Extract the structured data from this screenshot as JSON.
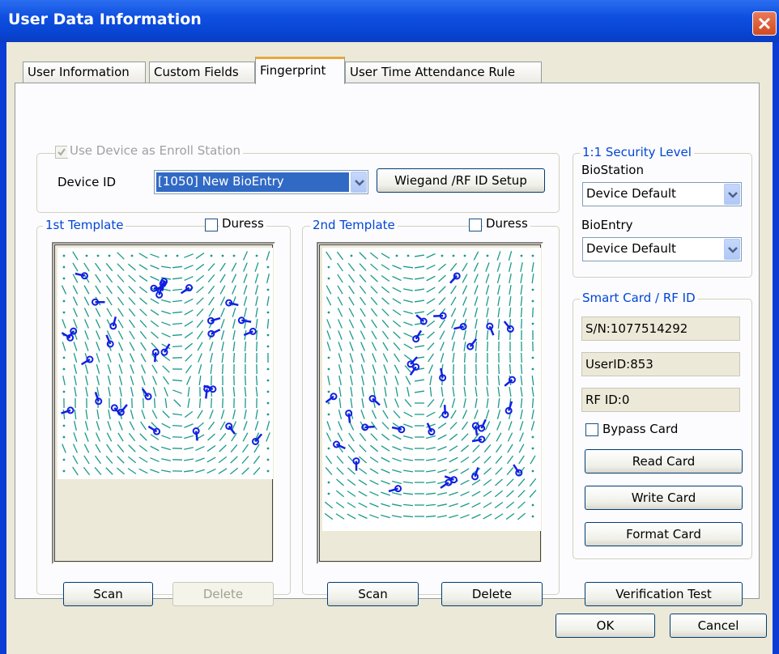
{
  "window": {
    "title": "User Data Information"
  },
  "tabs": [
    {
      "label": "User Information",
      "active": false
    },
    {
      "label": "Custom Fields",
      "active": false
    },
    {
      "label": "Fingerprint",
      "active": true
    },
    {
      "label": "User Time Attendance Rule",
      "active": false
    }
  ],
  "enroll": {
    "checkbox_label": "Use Device as Enroll Station",
    "checked": true,
    "enabled": false,
    "device_id_label": "Device ID",
    "device_id_value": "[1050] New BioEntry",
    "wiegand_button": "Wiegand /RF ID Setup"
  },
  "template1": {
    "title": "1st Template",
    "duress_label": "Duress",
    "duress_checked": false,
    "scan_label": "Scan",
    "delete_label": "Delete",
    "delete_enabled": false
  },
  "template2": {
    "title": "2nd Template",
    "duress_label": "Duress",
    "duress_checked": false,
    "scan_label": "Scan",
    "delete_label": "Delete",
    "delete_enabled": true
  },
  "security": {
    "title": "1:1 Security Level",
    "biostation_label": "BioStation",
    "biostation_value": "Device Default",
    "bioentry_label": "BioEntry",
    "bioentry_value": "Device Default"
  },
  "smartcard": {
    "title": "Smart Card / RF ID",
    "serial": "S/N:1077514292",
    "userid": "UserID:853",
    "rfid": "RF ID:0",
    "bypass_label": "Bypass Card",
    "bypass_checked": false,
    "read_label": "Read Card",
    "write_label": "Write Card",
    "format_label": "Format Card"
  },
  "verification_button": "Verification Test",
  "footer": {
    "ok_label": "OK",
    "cancel_label": "Cancel"
  },
  "colors": {
    "ridge": "#1a9a8a",
    "minutia": "#1020e0",
    "title_bar": "#0a46d8",
    "group_title": "#0046d5"
  }
}
